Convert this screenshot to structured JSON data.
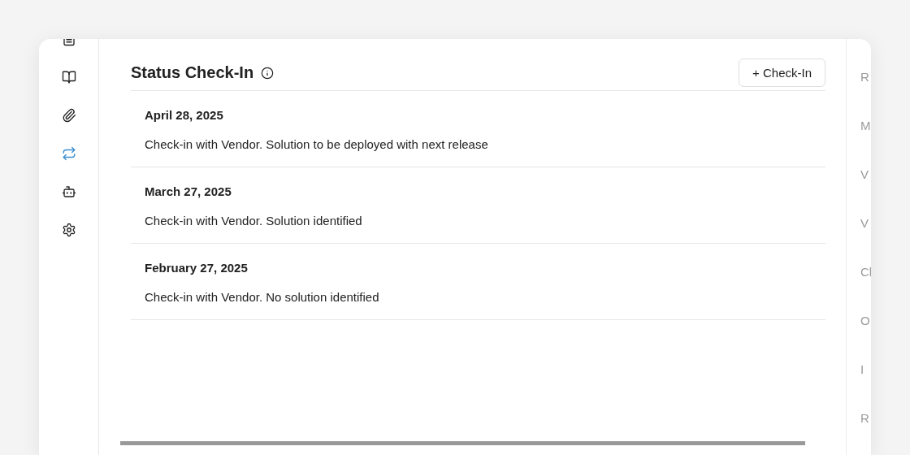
{
  "sidebar": {
    "items": [
      {
        "selected": false
      },
      {
        "selected": false
      },
      {
        "selected": false
      },
      {
        "selected": true
      },
      {
        "selected": false
      },
      {
        "selected": false
      }
    ]
  },
  "section": {
    "title": "Status Check-In",
    "add_button": "+ Check-In"
  },
  "entries": [
    {
      "date": "April 28, 2025",
      "note": "Check-in with Vendor. Solution to be deployed with next release"
    },
    {
      "date": "March 27, 2025",
      "note": "Check-in with Vendor. Solution identified"
    },
    {
      "date": "February 27, 2025",
      "note": "Check-in with Vendor. No solution identified"
    }
  ],
  "right_panel": {
    "labels": [
      "R",
      "M",
      "V",
      "V",
      "Cl",
      "O",
      "I",
      "R"
    ]
  }
}
